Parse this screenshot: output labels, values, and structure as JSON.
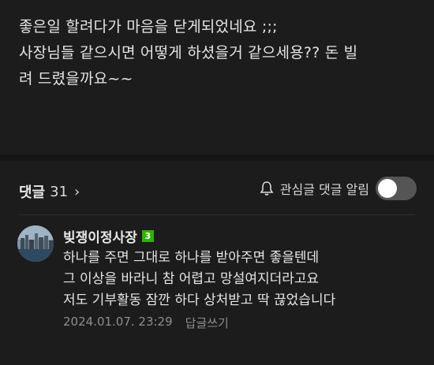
{
  "post": {
    "body": "좋은일 할려다가 마음을 닫게되었네요 ;;;\n사장님들 같으시면 어떻게 하셨을거 같으세용?? 돈 빌\n려 드렸을까요~~"
  },
  "comments_bar": {
    "label": "댓글",
    "count": "31",
    "chevron": "›",
    "notify_label": "관심글 댓글 알림",
    "notify_on": false
  },
  "comment": {
    "author": "빚쟁이정사장",
    "badge": "3",
    "text": "하나를 주면 그대로 하나를 받아주면 좋을텐데\n그 이상을 바라니 참 어렵고 망설여지더라고요\n저도 기부활동 잠깐 하다 상처받고 딱 끊었습니다",
    "timestamp": "2024.01.07. 23:29",
    "reply_label": "답글쓰기"
  }
}
